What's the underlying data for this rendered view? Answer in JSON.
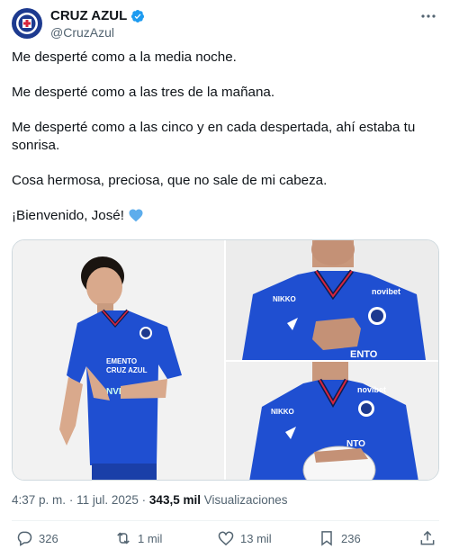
{
  "author": {
    "name": "CRUZ AZUL",
    "handle": "@CruzAzul",
    "verified_color": "#1d9bf0"
  },
  "tweet": {
    "lines": [
      "Me desperté como a la media noche.",
      "Me desperté como a las tres de la mañana.",
      "Me desperté como a las cinco y en cada despertada, ahí estaba tu sonrisa.",
      "Cosa hermosa, preciosa, que no sale de mi cabeza.",
      "¡Bienvenido, José!"
    ],
    "emoji": "light-blue-heart"
  },
  "meta": {
    "time": "4:37 p. m.",
    "separator1": "·",
    "date": "11 jul. 2025",
    "separator2": "·",
    "views": "343,5 mil",
    "views_label": "Visualizaciones"
  },
  "actions": {
    "replies": "326",
    "reposts": "1 mil",
    "likes": "13 mil",
    "bookmarks": "236"
  },
  "media": {
    "jersey_text_partial": "ENTO",
    "sponsor": "novibet",
    "kit": "NIKKO"
  },
  "colors": {
    "jersey_blue": "#1f4fd1",
    "accent": "#1d9bf0",
    "muted": "#536471"
  }
}
